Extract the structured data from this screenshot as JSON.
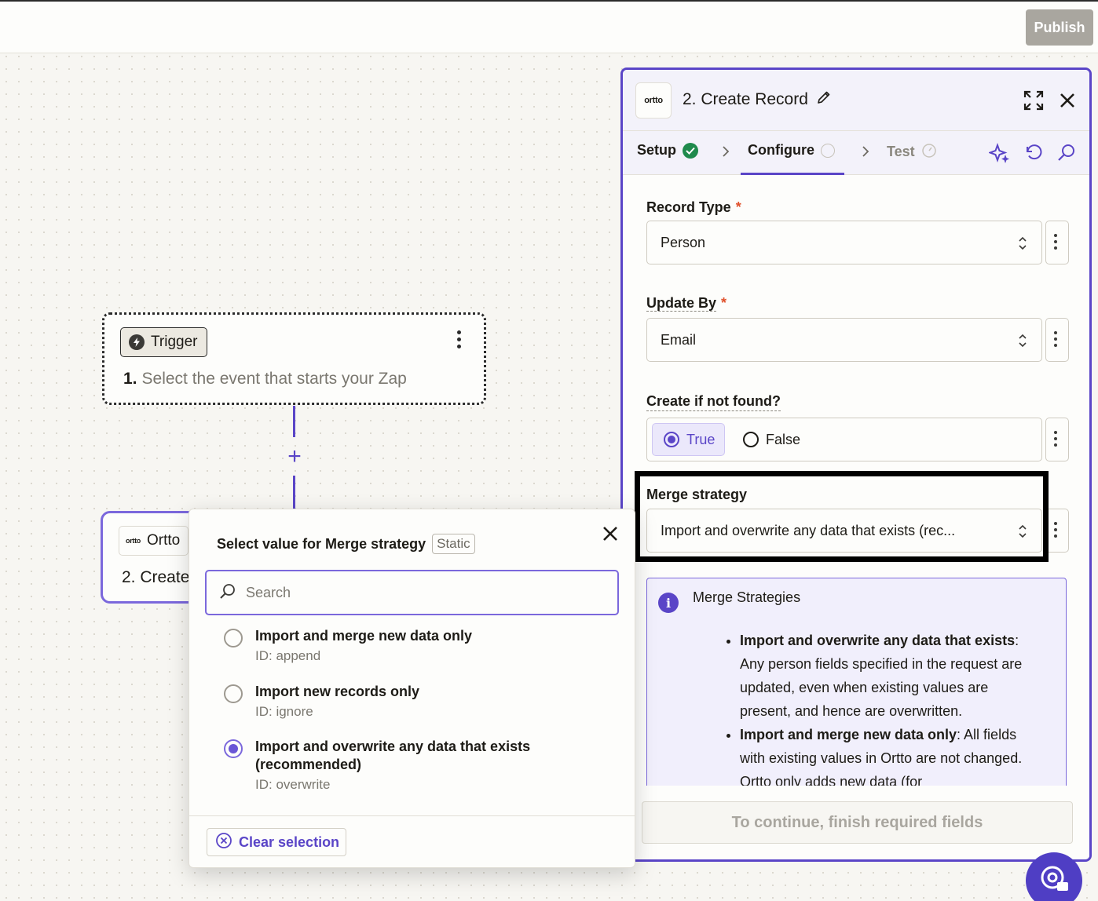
{
  "topbar": {
    "publish_label": "Publish"
  },
  "canvas": {
    "trigger": {
      "badge": "Trigger",
      "step_number": "1.",
      "title": "Select the event that starts your Zap"
    },
    "action": {
      "app_name": "Ortto",
      "logo_text": "ortto",
      "title": "2. Create"
    }
  },
  "popup": {
    "title": "Select value for Merge strategy",
    "badge": "Static",
    "search_placeholder": "Search",
    "options": [
      {
        "label": "Import and merge new data only",
        "id": "ID: append",
        "selected": false
      },
      {
        "label": "Import new records only",
        "id": "ID: ignore",
        "selected": false
      },
      {
        "label": "Import and overwrite any data that exists (recommended)",
        "id": "ID: overwrite",
        "selected": true
      }
    ],
    "clear_label": "Clear selection"
  },
  "panel": {
    "logo_text": "ortto",
    "title": "2. Create Record",
    "tabs": [
      {
        "label": "Setup",
        "status": "complete"
      },
      {
        "label": "Configure",
        "status": "active"
      },
      {
        "label": "Test",
        "status": "pending"
      }
    ],
    "fields": {
      "record_type": {
        "label": "Record Type",
        "required": "*",
        "value": "Person"
      },
      "update_by": {
        "label": "Update By",
        "required": "*",
        "value": "Email"
      },
      "create_if_not_found": {
        "label": "Create if not found?",
        "true_label": "True",
        "false_label": "False",
        "selected": "True"
      },
      "merge_strategy": {
        "label": "Merge strategy",
        "value": "Import and overwrite any data that exists (rec..."
      }
    },
    "info": {
      "title": "Merge Strategies",
      "items": [
        {
          "bold": "Import and overwrite any data that exists",
          "text": ": Any person fields specified in the request are updated, even when existing values are present, and hence are overwritten."
        },
        {
          "bold": "Import and merge new data only",
          "text": ": All fields with existing values in Ortto are not changed. Ortto only adds new data (for"
        }
      ]
    },
    "continue_label": "To continue, finish required fields"
  },
  "colors": {
    "accent": "#5a45c7",
    "success": "#1f8a4c",
    "required": "#e0502b"
  }
}
